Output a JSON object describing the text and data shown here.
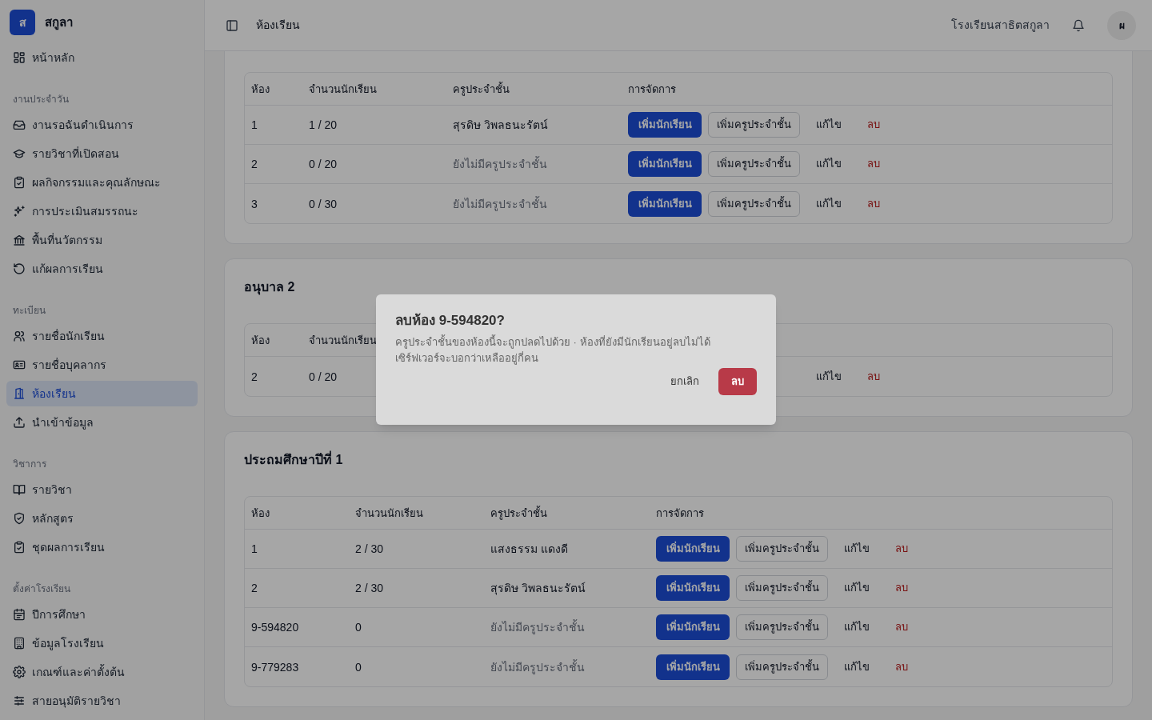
{
  "app": {
    "logo_letter": "ส",
    "name": "สกูลา"
  },
  "sidebar": {
    "groups": [
      {
        "items": [
          {
            "label": "หน้าหลัก",
            "selected": false
          }
        ]
      },
      {
        "heading": "งานประจำวัน",
        "items": [
          {
            "label": "งานรอฉันดำเนินการ",
            "selected": false
          },
          {
            "label": "รายวิชาที่เปิดสอน",
            "selected": false
          },
          {
            "label": "ผลกิจกรรมและคุณลักษณะ",
            "selected": false
          },
          {
            "label": "การประเมินสมรรถนะ",
            "selected": false
          },
          {
            "label": "พื้นที่นวัตกรรม",
            "selected": false
          },
          {
            "label": "แก้ผลการเรียน",
            "selected": false
          }
        ]
      },
      {
        "heading": "ทะเบียน",
        "items": [
          {
            "label": "รายชื่อนักเรียน",
            "selected": false
          },
          {
            "label": "รายชื่อบุคลากร",
            "selected": false
          },
          {
            "label": "ห้องเรียน",
            "selected": true
          },
          {
            "label": "นำเข้าข้อมูล",
            "selected": false
          }
        ]
      },
      {
        "heading": "วิชาการ",
        "items": [
          {
            "label": "รายวิชา",
            "selected": false
          },
          {
            "label": "หลักสูตร",
            "selected": false
          },
          {
            "label": "ชุดผลการเรียน",
            "selected": false
          }
        ]
      },
      {
        "heading": "ตั้งค่าโรงเรียน",
        "items": [
          {
            "label": "ปีการศึกษา",
            "selected": false
          },
          {
            "label": "ข้อมูลโรงเรียน",
            "selected": false
          },
          {
            "label": "เกณฑ์และค่าตั้งต้น",
            "selected": false
          },
          {
            "label": "สายอนุมัติรายวิชา",
            "selected": false
          }
        ]
      }
    ]
  },
  "header": {
    "title": "ห้องเรียน",
    "school": "โรงเรียนสาธิตสกูลา",
    "avatar": "ผ"
  },
  "sections": [
    {
      "columns": [
        "ห้อง",
        "จำนวนนักเรียน",
        "ครูประจำชั้น",
        "การจัดการ"
      ],
      "rows": [
        {
          "room": "1",
          "count": "1 / 20",
          "teacher": "สุรดิษ วิพลธนะรัตน์",
          "assigned": true,
          "add_student": "เพิ่มนักเรียน",
          "add_teacher": "เพิ่มครูประจำชั้น",
          "edit": "แก้ไข",
          "delete": "ลบ"
        },
        {
          "room": "2",
          "count": "0 / 20",
          "teacher": "ยังไม่มีครูประจำชั้น",
          "assigned": false,
          "add_student": "เพิ่มนักเรียน",
          "add_teacher": "เพิ่มครูประจำชั้น",
          "edit": "แก้ไข",
          "delete": "ลบ"
        },
        {
          "room": "3",
          "count": "0 / 30",
          "teacher": "ยังไม่มีครูประจำชั้น",
          "assigned": false,
          "add_student": "เพิ่มนักเรียน",
          "add_teacher": "เพิ่มครูประจำชั้น",
          "edit": "แก้ไข",
          "delete": "ลบ"
        }
      ]
    },
    {
      "title": "อนุบาล 2",
      "columns": [
        "ห้อง",
        "จำนวนนักเรียน"
      ],
      "rows": [
        {
          "room": "2",
          "count": "0 / 20",
          "edit": "แก้ไข",
          "delete": "ลบ"
        }
      ]
    },
    {
      "title": "ประถมศึกษาปีที่ 1",
      "columns": [
        "ห้อง",
        "จำนวนนักเรียน",
        "ครูประจำชั้น",
        "การจัดการ"
      ],
      "rows": [
        {
          "room": "1",
          "count": "2 / 30",
          "teacher": "แสงธรรม แดงดี",
          "assigned": true,
          "add_student": "เพิ่มนักเรียน",
          "add_teacher": "เพิ่มครูประจำชั้น",
          "edit": "แก้ไข",
          "delete": "ลบ"
        },
        {
          "room": "2",
          "count": "2 / 30",
          "teacher": "สุรดิษ วิพลธนะรัตน์",
          "assigned": true,
          "add_student": "เพิ่มนักเรียน",
          "add_teacher": "เพิ่มครูประจำชั้น",
          "edit": "แก้ไข",
          "delete": "ลบ"
        },
        {
          "room": "9-594820",
          "count": "0",
          "teacher": "ยังไม่มีครูประจำชั้น",
          "assigned": false,
          "add_student": "เพิ่มนักเรียน",
          "add_teacher": "เพิ่มครูประจำชั้น",
          "edit": "แก้ไข",
          "delete": "ลบ"
        },
        {
          "room": "9-779283",
          "count": "0",
          "teacher": "ยังไม่มีครูประจำชั้น",
          "assigned": false,
          "add_student": "เพิ่มนักเรียน",
          "add_teacher": "เพิ่มครูประจำชั้น",
          "edit": "แก้ไข",
          "delete": "ลบ"
        }
      ]
    }
  ],
  "dialog": {
    "title": "ลบห้อง 9-594820?",
    "message": "ครูประจำชั้นของห้องนี้จะถูกปลดไปด้วย · ห้องที่ยังมีนักเรียนอยู่ลบไม่ได้ เซิร์ฟเวอร์จะบอกว่าเหลืออยู่กี่คน",
    "cancel": "ยกเลิก",
    "confirm": "ลบ"
  }
}
